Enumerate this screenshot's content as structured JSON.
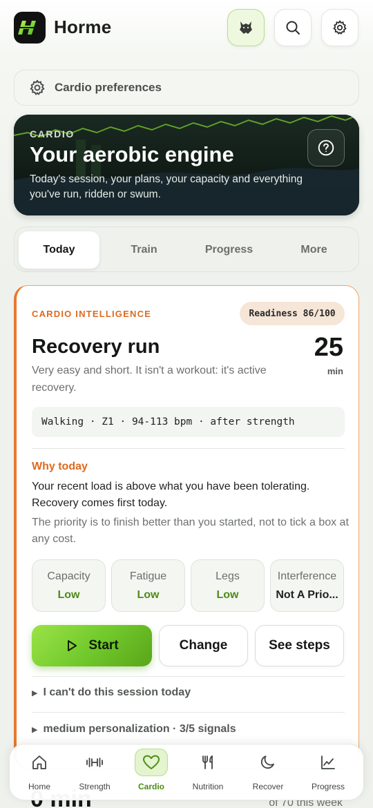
{
  "header": {
    "app_title": "Horme",
    "icons": {
      "logo": "horme-logo",
      "avatar": "wolf-avatar-icon",
      "search": "search-icon",
      "settings": "gear-icon"
    }
  },
  "preferences": {
    "label": "Cardio preferences",
    "icon": "gear-icon"
  },
  "hero": {
    "eyebrow": "CARDIO",
    "title": "Your aerobic engine",
    "description": "Today's session, your plans, your capacity and everything you've run, ridden or swum.",
    "icon": "help-circle-icon"
  },
  "tabs": [
    {
      "label": "Today",
      "active": true
    },
    {
      "label": "Train",
      "active": false
    },
    {
      "label": "Progress",
      "active": false
    },
    {
      "label": "More",
      "active": false
    }
  ],
  "session": {
    "eyebrow": "CARDIO INTELLIGENCE",
    "readiness": "Readiness 86/100",
    "title": "Recovery run",
    "duration_value": "25",
    "duration_unit": "min",
    "description": "Very easy and short. It isn't a workout: it's active recovery.",
    "chip": "Walking · Z1 · 94-113 bpm · after strength",
    "why_heading": "Why today",
    "why_text": "Your recent load is above what you have been tolerating. Recovery comes first today.",
    "why_note": "The priority is to finish better than you started, not to tick a box at any cost.",
    "metrics": [
      {
        "label": "Capacity",
        "value": "Low"
      },
      {
        "label": "Fatigue",
        "value": "Low"
      },
      {
        "label": "Legs",
        "value": "Low"
      },
      {
        "label": "Interference",
        "value": "Not A Prio..."
      }
    ],
    "actions": {
      "start": "Start",
      "change": "Change",
      "steps": "See steps"
    },
    "disclosures": [
      "I can't do this session today",
      "medium personalization · 3/5 signals"
    ],
    "accent_color": "#e8782e",
    "positive_color": "#4f8a16"
  },
  "peek": {
    "left": "0 min",
    "right": "of 70 this week"
  },
  "nav": [
    {
      "label": "Home",
      "icon": "home-icon",
      "active": false
    },
    {
      "label": "Strength",
      "icon": "dumbbell-icon",
      "active": false
    },
    {
      "label": "Cardio",
      "icon": "heart-icon",
      "active": true
    },
    {
      "label": "Nutrition",
      "icon": "fork-knife-icon",
      "active": false
    },
    {
      "label": "Recover",
      "icon": "moon-icon",
      "active": false
    },
    {
      "label": "Progress",
      "icon": "chart-icon",
      "active": false
    }
  ]
}
